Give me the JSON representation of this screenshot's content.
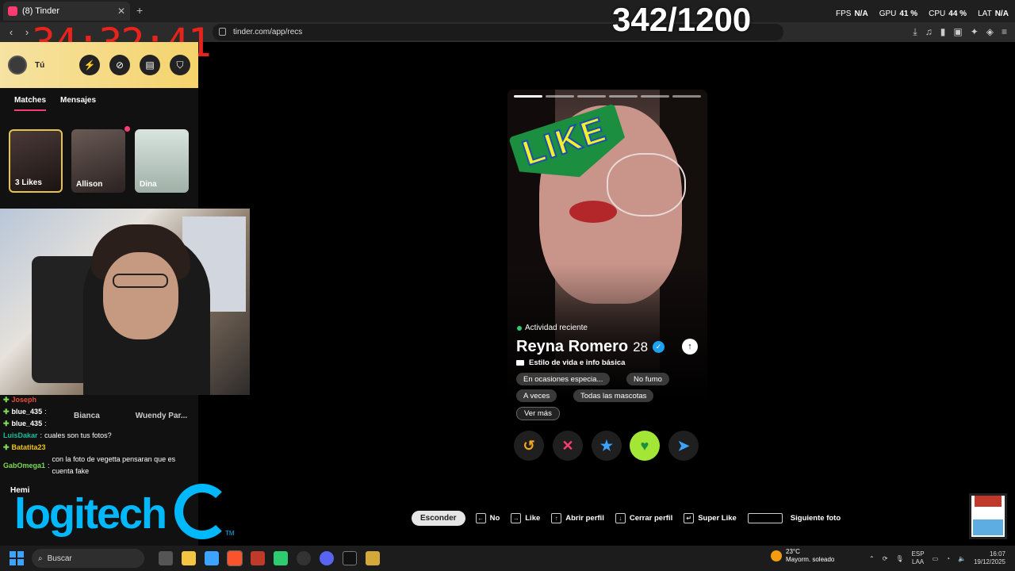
{
  "browser": {
    "tab_title": "(8) Tinder",
    "new_tab": "+",
    "url": "tinder.com/app/recs"
  },
  "overlay": {
    "timer": "34:32:41",
    "counter": "342/1200",
    "fps_label": "FPS",
    "fps_value": "N/A",
    "gpu_label": "GPU",
    "gpu_value": "41 %",
    "cpu_label": "CPU",
    "cpu_value": "44 %",
    "lat_label": "LAT",
    "lat_value": "N/A"
  },
  "sidebar": {
    "user_label": "Tú",
    "tabs": [
      "Matches",
      "Mensajes"
    ],
    "matches": [
      {
        "label": "3 Likes"
      },
      {
        "label": "Allison"
      },
      {
        "label": "Dina"
      }
    ],
    "lower_matches": [
      "Bianca",
      "Wuendy Par..."
    ]
  },
  "chat": [
    {
      "user": "Joseph",
      "color": "#e74c3c",
      "msg": ""
    },
    {
      "user": "blue_435",
      "color": "#ffffff",
      "msg": ""
    },
    {
      "user": "blue_435",
      "color": "#ffffff",
      "msg": ""
    },
    {
      "user": "LuisDakar",
      "color": "#1abc9c",
      "msg": "cuales son tus fotos?"
    },
    {
      "user": "Batatita23",
      "color": "#f1c40f",
      "msg": ""
    },
    {
      "user": "GabOmega1",
      "color": "#7ed957",
      "msg": "con la foto de vegetta pensaran que es cuenta fake"
    }
  ],
  "sponsor": {
    "hemi": "Hemi",
    "logo": "logitech",
    "tm": "TM",
    "brand_color": "#00b8fc"
  },
  "profile": {
    "stamp": "LIKE",
    "recent": "Actividad reciente",
    "name": "Reyna Romero",
    "age": "28",
    "section": "Estilo de vida e info básica",
    "chips": [
      "En ocasiones especia...",
      "No fumo",
      "A veces",
      "Todas las mascotas"
    ],
    "more": "Ver más",
    "photo_count": 6
  },
  "actions": {
    "rewind": "↺",
    "nope": "✕",
    "super": "★",
    "like": "♥",
    "boost": "➤"
  },
  "shortcuts": {
    "hide": "Esconder",
    "items": [
      {
        "key": "←",
        "label": "No"
      },
      {
        "key": "→",
        "label": "Like"
      },
      {
        "key": "↑",
        "label": "Abrir perfil"
      },
      {
        "key": "↓",
        "label": "Cerrar perfil"
      },
      {
        "key": "↵",
        "label": "Super Like"
      }
    ],
    "space_label": "Siguiente foto"
  },
  "taskbar": {
    "search": "Buscar",
    "weather_temp": "23°C",
    "weather_desc": "Mayorm. soleado",
    "lang1": "ESP",
    "lang2": "LAA",
    "time": "16:07",
    "date": "19/12/2025"
  },
  "colors": {
    "tinder_pink": "#fe3c72",
    "like_green": "#a3e635",
    "accent_blue": "#3ca4ff"
  }
}
